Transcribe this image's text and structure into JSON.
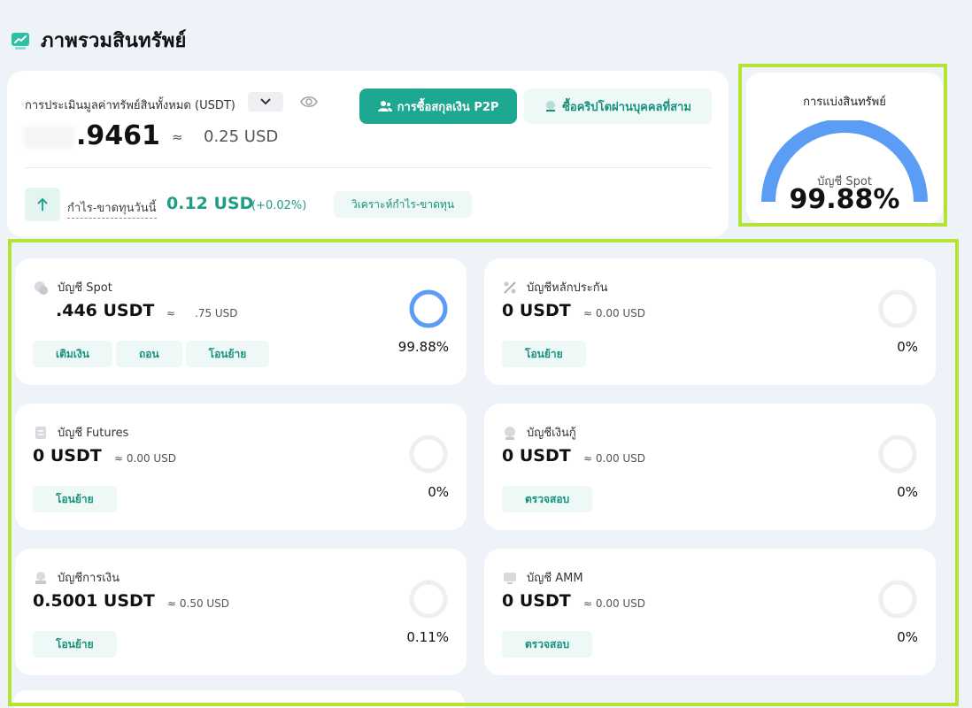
{
  "header": {
    "title": "ภาพรวมสินทรัพย์",
    "icon": "chart-up-icon",
    "accent": "#1fa891"
  },
  "summary": {
    "valuation_label": "การประเมินมูลค่าทรัพย์สินทั้งหมด (USDT)",
    "balance_main": ".9461",
    "approx": "≈",
    "balance_usd": "0.25 USD",
    "btn_p2p": "การซื้อสกุลเงิน P2P",
    "btn_third_party": "ซื้อคริปโตผ่านบุคคลที่สาม",
    "pnl_label": "กำไร-ขาดทุนวันนี้",
    "pnl_value": "0.12 USD",
    "pnl_percent": "(+0.02%)",
    "btn_analysis": "วิเคราะห์กำไร-ขาดทุน"
  },
  "breakdown": {
    "title": "การแบ่งสินทรัพย์",
    "caption": "บัญชี Spot",
    "value": "99.88%",
    "fraction": 0.9988,
    "color": "#5b9cf5"
  },
  "accounts": [
    {
      "name": "บัญชี Spot",
      "icon": "spot-coin-icon",
      "amount": ".446 USDT",
      "approx": "≈",
      "approx_value": ".75 USD",
      "actions": [
        "เติมเงิน",
        "ถอน",
        "โอนย้าย"
      ],
      "percent": "99.88%",
      "fraction": 0.9988
    },
    {
      "name": "บัญชีหลักประกัน",
      "icon": "collateral-icon",
      "amount": "0 USDT",
      "approx": "≈ 0.00 USD",
      "actions": [
        "โอนย้าย"
      ],
      "percent": "0%",
      "fraction": 0
    },
    {
      "name": "บัญชี Futures",
      "icon": "futures-icon",
      "amount": "0 USDT",
      "approx": "≈ 0.00 USD",
      "actions": [
        "โอนย้าย"
      ],
      "percent": "0%",
      "fraction": 0
    },
    {
      "name": "บัญชีเงินกู้",
      "icon": "loan-icon",
      "amount": "0 USDT",
      "approx": "≈ 0.00 USD",
      "actions": [
        "ตรวจสอบ"
      ],
      "percent": "0%",
      "fraction": 0
    },
    {
      "name": "บัญชีการเงิน",
      "icon": "finance-icon",
      "amount": "0.5001 USDT",
      "approx": "≈ 0.50 USD",
      "actions": [
        "โอนย้าย"
      ],
      "percent": "0.11%",
      "fraction": 0.0011
    },
    {
      "name": "บัญชี AMM",
      "icon": "amm-icon",
      "amount": "0 USDT",
      "approx": "≈ 0.00 USD",
      "actions": [
        "ตรวจสอบ"
      ],
      "percent": "0%",
      "fraction": 0
    }
  ]
}
